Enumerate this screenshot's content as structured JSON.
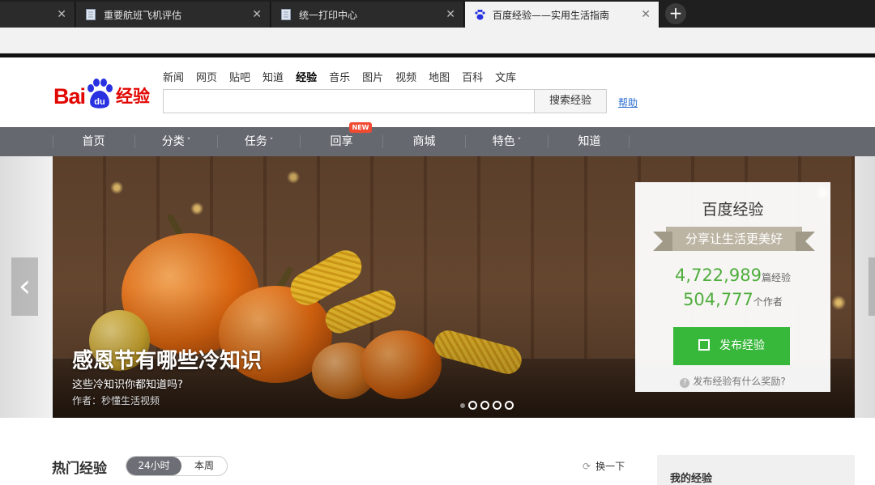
{
  "browser": {
    "tabs": [
      {
        "label": "",
        "active": false
      },
      {
        "label": "重要航班飞机评估",
        "active": false
      },
      {
        "label": "统一打印中心",
        "active": false
      },
      {
        "label": "百度经验——实用生活指南",
        "active": true
      }
    ],
    "new_tab_icon": "plus-icon"
  },
  "header": {
    "logo": {
      "bai": "Bai",
      "du": "du",
      "jingyan": "经验"
    },
    "topnav": [
      "新闻",
      "网页",
      "贴吧",
      "知道",
      "经验",
      "音乐",
      "图片",
      "视频",
      "地图",
      "百科",
      "文库"
    ],
    "current_nav": "经验",
    "search": {
      "value": "",
      "button": "搜索经验"
    },
    "help": "帮助"
  },
  "mainnav": {
    "items": [
      "首页",
      "分类",
      "任务",
      "回享",
      "商城",
      "特色",
      "知道"
    ],
    "dropdown_items": [
      "分类",
      "任务",
      "特色"
    ],
    "new_badge": "NEW"
  },
  "banner": {
    "title": "感恩节有哪些冷知识",
    "subtitle": "这些冷知识你都知道吗?",
    "author": "作者：秒懂生活视频",
    "slide_count": 4,
    "current_slide": 1
  },
  "card": {
    "title": "百度经验",
    "slogan": "分享让生活更美好",
    "experiences_count": "4,722,989",
    "experiences_unit": "篇经验",
    "authors_count": "504,777",
    "authors_unit": "个作者",
    "publish_button": "发布经验",
    "reward_link": "发布经验有什么奖励?"
  },
  "hot": {
    "title": "热门经验",
    "tabs": [
      "24小时",
      "本周"
    ],
    "active_tab": "24小时",
    "refresh": "换一下"
  },
  "sidebar": {
    "title": "我的经验"
  },
  "colors": {
    "brand_red": "#e10601",
    "paw_blue": "#2932e1",
    "green": "#38b83b",
    "nav_bg": "#666870"
  }
}
